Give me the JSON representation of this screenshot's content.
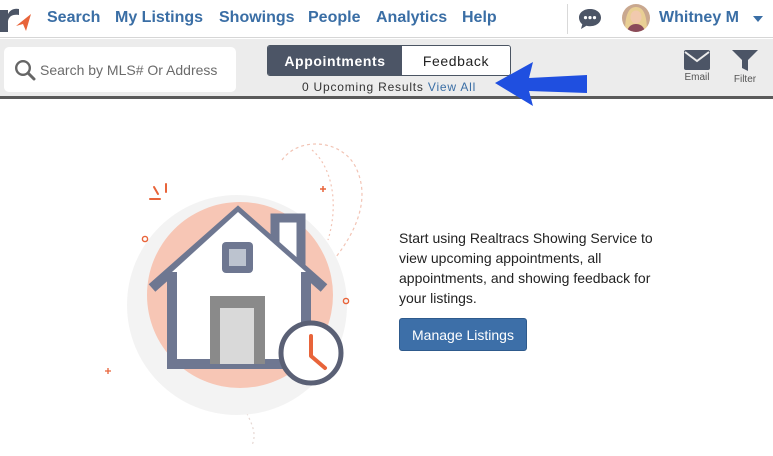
{
  "nav": {
    "links": [
      "Search",
      "My Listings",
      "Showings",
      "People",
      "Analytics",
      "Help"
    ],
    "user_name": "Whitney M"
  },
  "toolbar": {
    "search_placeholder": "Search by MLS# Or Address",
    "tabs": [
      {
        "label": "Appointments",
        "active": true
      },
      {
        "label": "Feedback",
        "active": false
      }
    ],
    "results_text": "0 Upcoming Results",
    "view_all_label": "View All",
    "email_label": "Email",
    "filter_label": "Filter"
  },
  "empty_state": {
    "message": "Start using Realtracs Showing Service to view upcoming appointments, all appointments, and showing feedback for your listings.",
    "button_label": "Manage Listings"
  },
  "colors": {
    "brand_blue": "#3a6ea5",
    "accent_orange": "#e8643a",
    "tab_active": "#4c5566",
    "annotation_arrow": "#1f4fe0"
  },
  "icons": [
    "realtracs-logo",
    "chat-icon",
    "chevron-down-icon",
    "search-icon",
    "envelope-icon",
    "funnel-icon",
    "clock-icon",
    "house-illustration"
  ]
}
